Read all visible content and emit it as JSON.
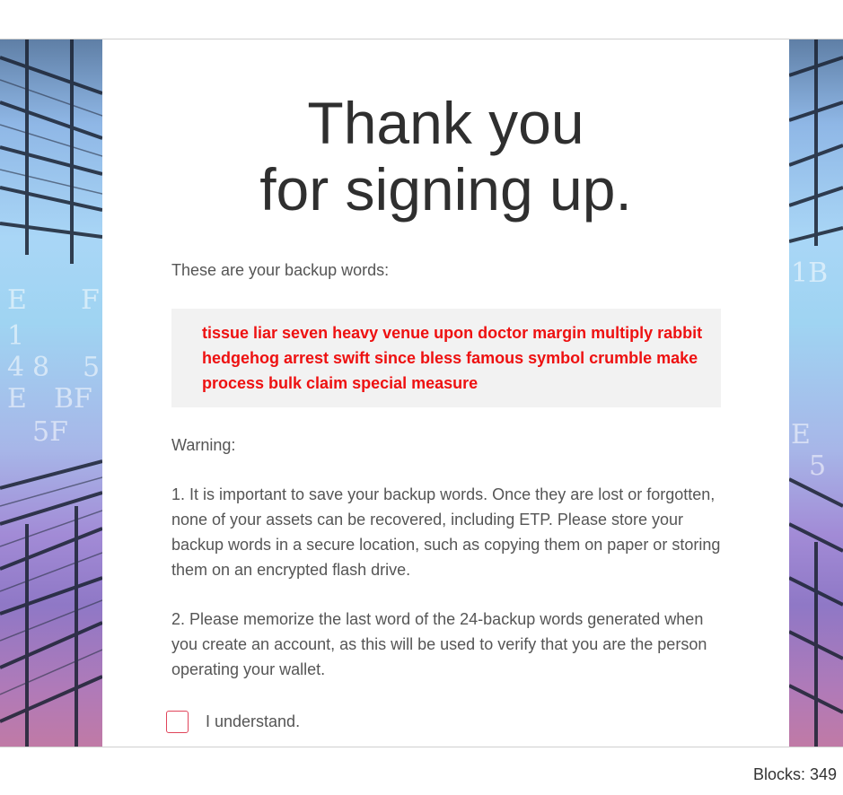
{
  "signup": {
    "title_line1": "Thank you",
    "title_line2": "for signing up.",
    "backup_label": "These are your backup words:",
    "backup_words": "tissue liar seven heavy venue upon doctor margin multiply rabbit hedgehog arrest swift since bless famous symbol crumble make process bulk claim special measure",
    "warning_label": "Warning:",
    "warning_1": "1. It is important to save your backup words. Once they are lost or forgotten, none of your assets can be recovered, including ETP. Please store your backup words in a secure location, such as copying them on paper or storing them on an encrypted flash drive.",
    "warning_2": "2. Please memorize the last word of the 24-backup words generated when you create an account, as this will be used to verify that you are the person operating your wallet.",
    "confirm_label": "I understand.",
    "confirm_checked": false
  },
  "status": {
    "blocks": "Blocks: 349"
  },
  "colors": {
    "words": "#ee1111",
    "words_box": "#f2f2f2",
    "checkbox_border": "#e0445a",
    "body_text": "#555555",
    "title_text": "#2f2f2f"
  },
  "icons": {
    "checkbox": "empty-checkbox-icon"
  }
}
